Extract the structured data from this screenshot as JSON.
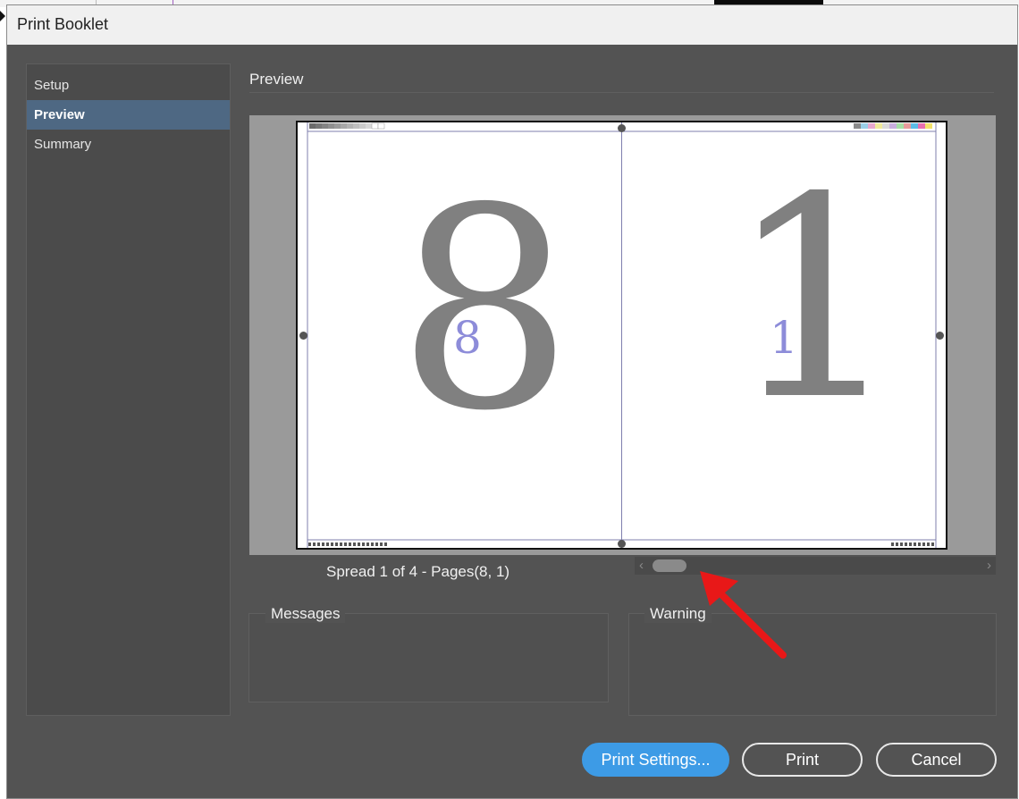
{
  "window": {
    "title": "Print Booklet"
  },
  "sidebar": {
    "items": [
      {
        "label": "Setup"
      },
      {
        "label": "Preview"
      },
      {
        "label": "Summary"
      }
    ]
  },
  "preview": {
    "section_title": "Preview",
    "left_page_number": "8",
    "right_page_number": "1",
    "spread_label": "Spread 1 of 4 - Pages(8, 1)"
  },
  "panels": {
    "messages_title": "Messages",
    "warning_title": "Warning"
  },
  "buttons": {
    "print_settings": "Print Settings...",
    "print": "Print",
    "cancel": "Cancel"
  },
  "colors": {
    "accent": "#3d9be6",
    "selection": "#4e6883",
    "dialog_bg": "#535353",
    "annotation_arrow": "#e81818"
  }
}
